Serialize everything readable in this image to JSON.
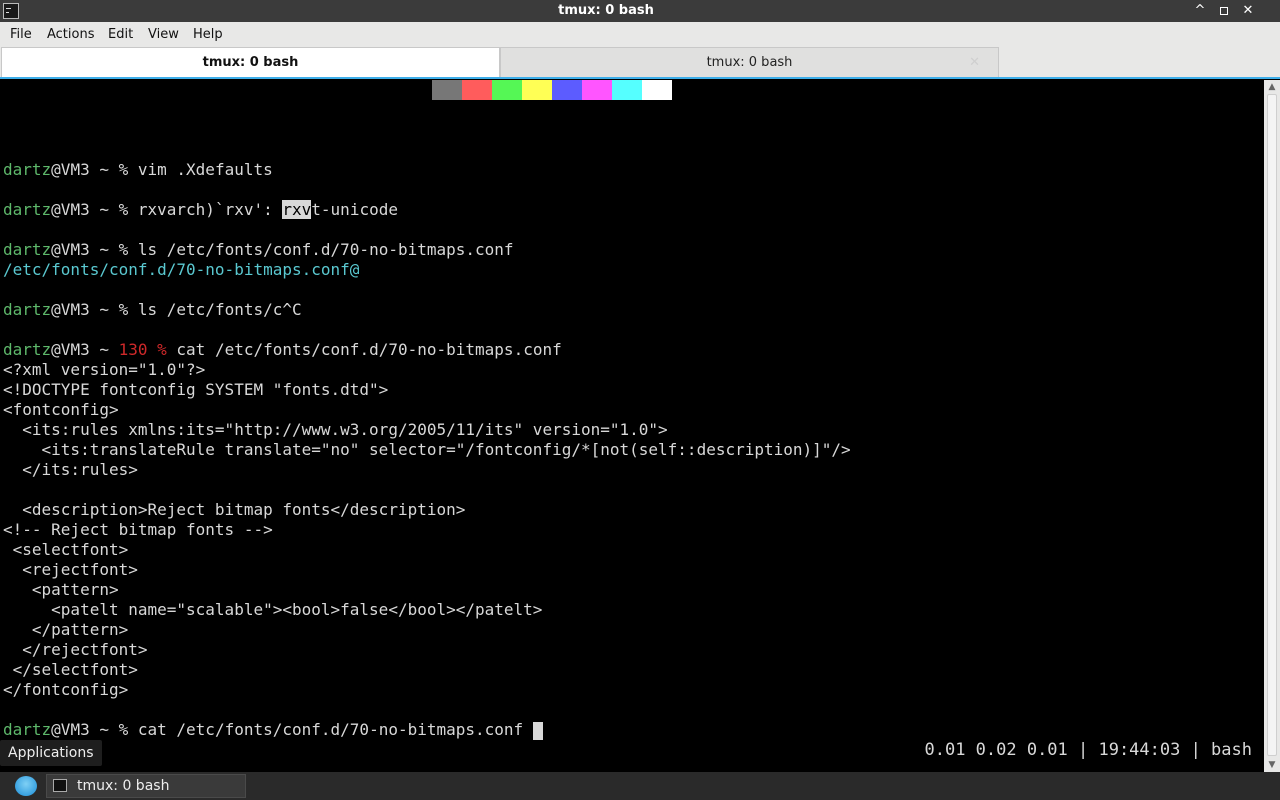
{
  "window": {
    "title": "tmux: 0 bash",
    "controls": {
      "minimize": "^",
      "maximize": "▫",
      "close": "✕"
    }
  },
  "menubar": {
    "items": [
      "File",
      "Actions",
      "Edit",
      "View",
      "Help"
    ]
  },
  "tabs": [
    {
      "label": "tmux: 0 bash",
      "active": true
    },
    {
      "label": "tmux: 0 bash",
      "active": false,
      "close": "✕"
    }
  ],
  "terminal": {
    "palette": [
      "#777777",
      "#ff5c5c",
      "#55f755",
      "#ffff55",
      "#5c5cff",
      "#ff55ff",
      "#55ffff",
      "#ffffff"
    ],
    "lines": [
      {
        "prompt_user": "dartz",
        "prompt_rest": "@VM3 ~ % ",
        "cmd": "vim .Xdefaults"
      },
      {
        "prompt_user": "dartz",
        "prompt_rest": "@VM3 ~ % ",
        "cmd_before": "rxvarch)`rxv': ",
        "cmd_selected": "rxv",
        "cmd_after": "t-unicode"
      },
      {
        "prompt_user": "dartz",
        "prompt_rest": "@VM3 ~ % ",
        "cmd": "ls /etc/fonts/conf.d/70-no-bitmaps.conf"
      },
      {
        "output": "/etc/fonts/conf.d/70-no-bitmaps.conf@"
      },
      {
        "prompt_user": "dartz",
        "prompt_rest": "@VM3 ~ % ",
        "cmd": "ls /etc/fonts/c^C"
      },
      {
        "prompt_user": "dartz",
        "prompt_rest": "@VM3 ~ ",
        "exit_code": "130 %",
        "cmd": " cat /etc/fonts/conf.d/70-no-bitmaps.conf"
      },
      {
        "output": "<?xml version=\"1.0\"?>"
      },
      {
        "output": "<!DOCTYPE fontconfig SYSTEM \"fonts.dtd\">"
      },
      {
        "output": "<fontconfig>"
      },
      {
        "output": "  <its:rules xmlns:its=\"http://www.w3.org/2005/11/its\" version=\"1.0\">"
      },
      {
        "output": "    <its:translateRule translate=\"no\" selector=\"/fontconfig/*[not(self::description)]\"/>"
      },
      {
        "output": "  </its:rules>"
      },
      {
        "output": "  <description>Reject bitmap fonts</description>"
      },
      {
        "output": "<!-- Reject bitmap fonts -->"
      },
      {
        "output": " <selectfont>"
      },
      {
        "output": "  <rejectfont>"
      },
      {
        "output": "   <pattern>"
      },
      {
        "output": "     <patelt name=\"scalable\"><bool>false</bool></patelt>"
      },
      {
        "output": "   </pattern>"
      },
      {
        "output": "  </rejectfont>"
      },
      {
        "output": " </selectfont>"
      },
      {
        "output": "</fontconfig>"
      },
      {
        "prompt_user": "dartz",
        "prompt_rest": "@VM3 ~ % ",
        "cmd": "cat /etc/fonts/conf.d/70-no-bitmaps.conf "
      }
    ],
    "status": "0.01 0.02 0.01 | 19:44:03 | bash"
  },
  "tooltip": {
    "label": "Applications"
  },
  "taskbar": {
    "task_label": "tmux: 0 bash"
  },
  "colors": {
    "prompt_user": "#5eb86b",
    "exit_code": "#d0292a",
    "symlink": "#5ac8d0",
    "accent": "#3daee9"
  }
}
